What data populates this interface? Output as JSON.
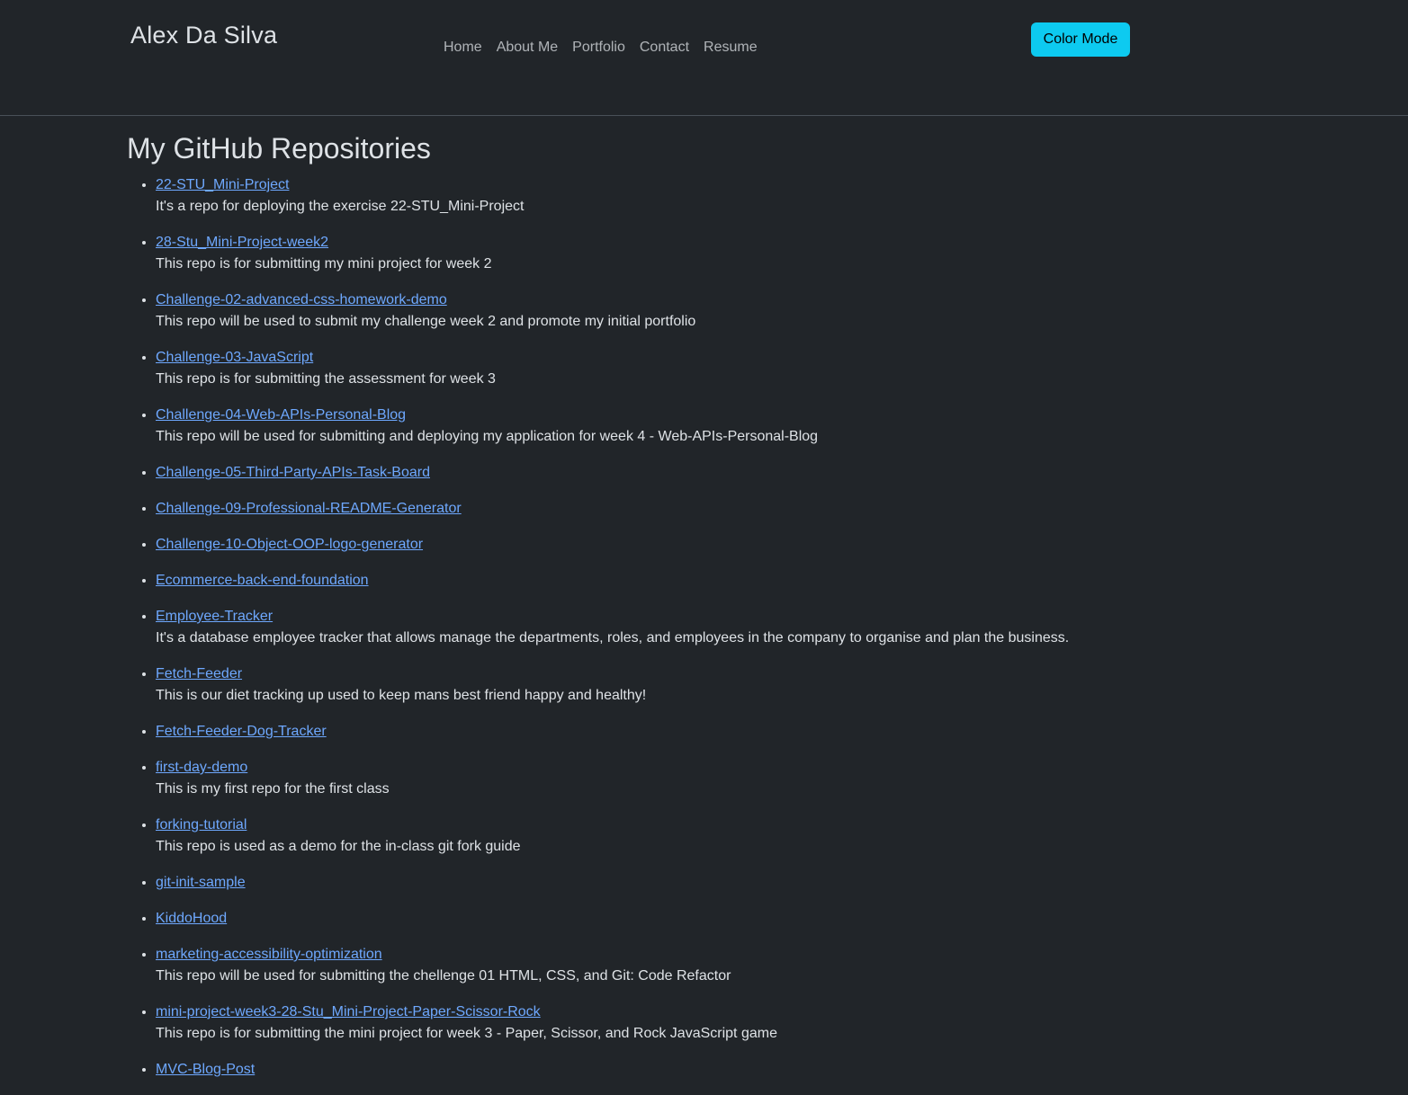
{
  "header": {
    "brand": "Alex Da Silva",
    "nav": [
      "Home",
      "About Me",
      "Portfolio",
      "Contact",
      "Resume"
    ],
    "color_mode_label": "Color Mode"
  },
  "main": {
    "title": "My GitHub Repositories",
    "repos": [
      {
        "name": "22-STU_Mini-Project",
        "desc": "It's a repo for deploying the exercise 22-STU_Mini-Project"
      },
      {
        "name": "28-Stu_Mini-Project-week2",
        "desc": "This repo is for submitting my mini project for week 2"
      },
      {
        "name": "Challenge-02-advanced-css-homework-demo",
        "desc": "This repo will be used to submit my challenge week 2 and promote my initial portfolio"
      },
      {
        "name": "Challenge-03-JavaScript",
        "desc": "This repo is for submitting the assessment for week 3"
      },
      {
        "name": "Challenge-04-Web-APIs-Personal-Blog",
        "desc": "This repo will be used for submitting and deploying my application for week 4 - Web-APIs-Personal-Blog"
      },
      {
        "name": "Challenge-05-Third-Party-APIs-Task-Board",
        "desc": ""
      },
      {
        "name": "Challenge-09-Professional-README-Generator",
        "desc": ""
      },
      {
        "name": "Challenge-10-Object-OOP-logo-generator",
        "desc": ""
      },
      {
        "name": "Ecommerce-back-end-foundation",
        "desc": ""
      },
      {
        "name": "Employee-Tracker",
        "desc": "It's a database employee tracker that allows manage the departments, roles, and employees in the company to organise and plan the business."
      },
      {
        "name": "Fetch-Feeder",
        "desc": "This is our diet tracking up used to keep mans best friend happy and healthy!"
      },
      {
        "name": "Fetch-Feeder-Dog-Tracker",
        "desc": ""
      },
      {
        "name": "first-day-demo",
        "desc": "This is my first repo for the first class"
      },
      {
        "name": "forking-tutorial",
        "desc": "This repo is used as a demo for the in-class git fork guide"
      },
      {
        "name": "git-init-sample",
        "desc": ""
      },
      {
        "name": "KiddoHood",
        "desc": ""
      },
      {
        "name": "marketing-accessibility-optimization",
        "desc": "This repo will be used for submitting the chellenge 01 HTML, CSS, and Git: Code Refactor"
      },
      {
        "name": "mini-project-week3-28-Stu_Mini-Project-Paper-Scissor-Rock",
        "desc": "This repo is for submitting the mini project for week 3 - Paper, Scissor, and Rock JavaScript game"
      },
      {
        "name": "MVC-Blog-Post",
        "desc": ""
      }
    ]
  }
}
